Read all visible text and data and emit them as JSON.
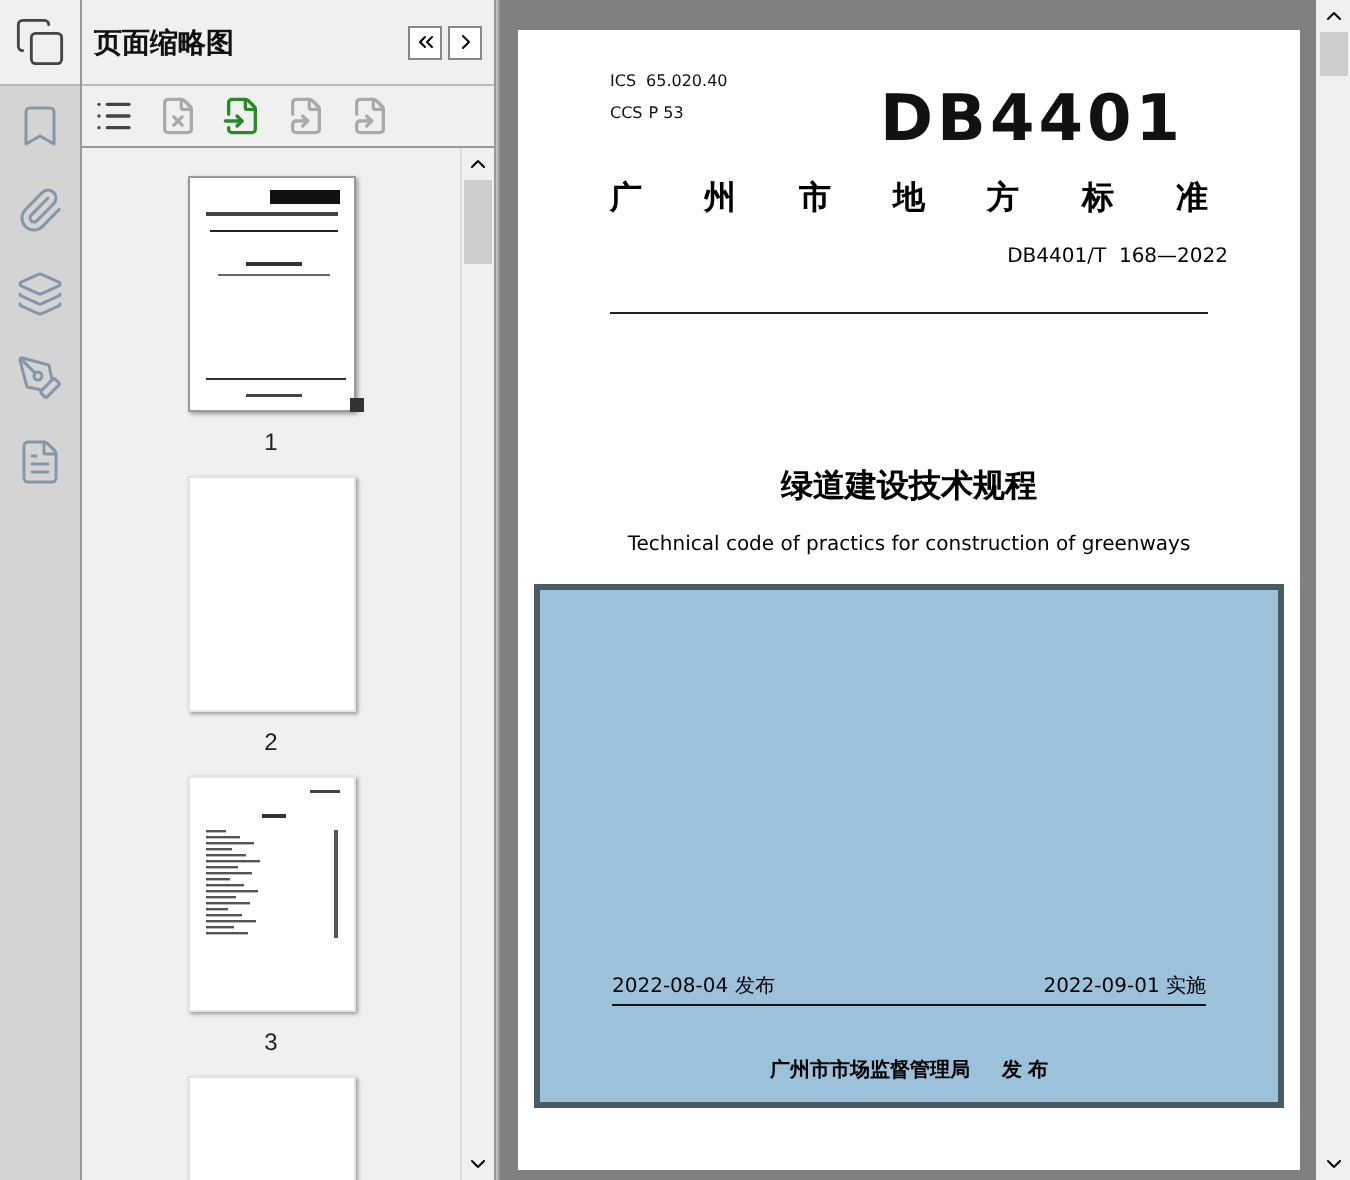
{
  "panel": {
    "title": "页面缩略图"
  },
  "thumbnails": [
    {
      "kind": "cover",
      "label": "1",
      "selected": true
    },
    {
      "kind": "blank",
      "label": "2",
      "selected": false
    },
    {
      "kind": "toc",
      "label": "3",
      "selected": false
    },
    {
      "kind": "blank",
      "selected": false
    }
  ],
  "document": {
    "ics_label": "ICS",
    "ics": "65.020.40",
    "ccs_label": "CCS",
    "ccs": "P 53",
    "logo": "DB4401",
    "standard_type": [
      "广",
      "州",
      "市",
      "地",
      "方",
      "标",
      "准"
    ],
    "number": "DB4401/T  168—2022",
    "title_zh": "绿道建设技术规程",
    "title_en": "Technical code of practics for construction of greenways",
    "publish_date": "2022-08-04 发布",
    "effective_date": "2022-09-01 实施",
    "issuer": "广州市市场监督管理局",
    "issuer_action": "发 布"
  }
}
